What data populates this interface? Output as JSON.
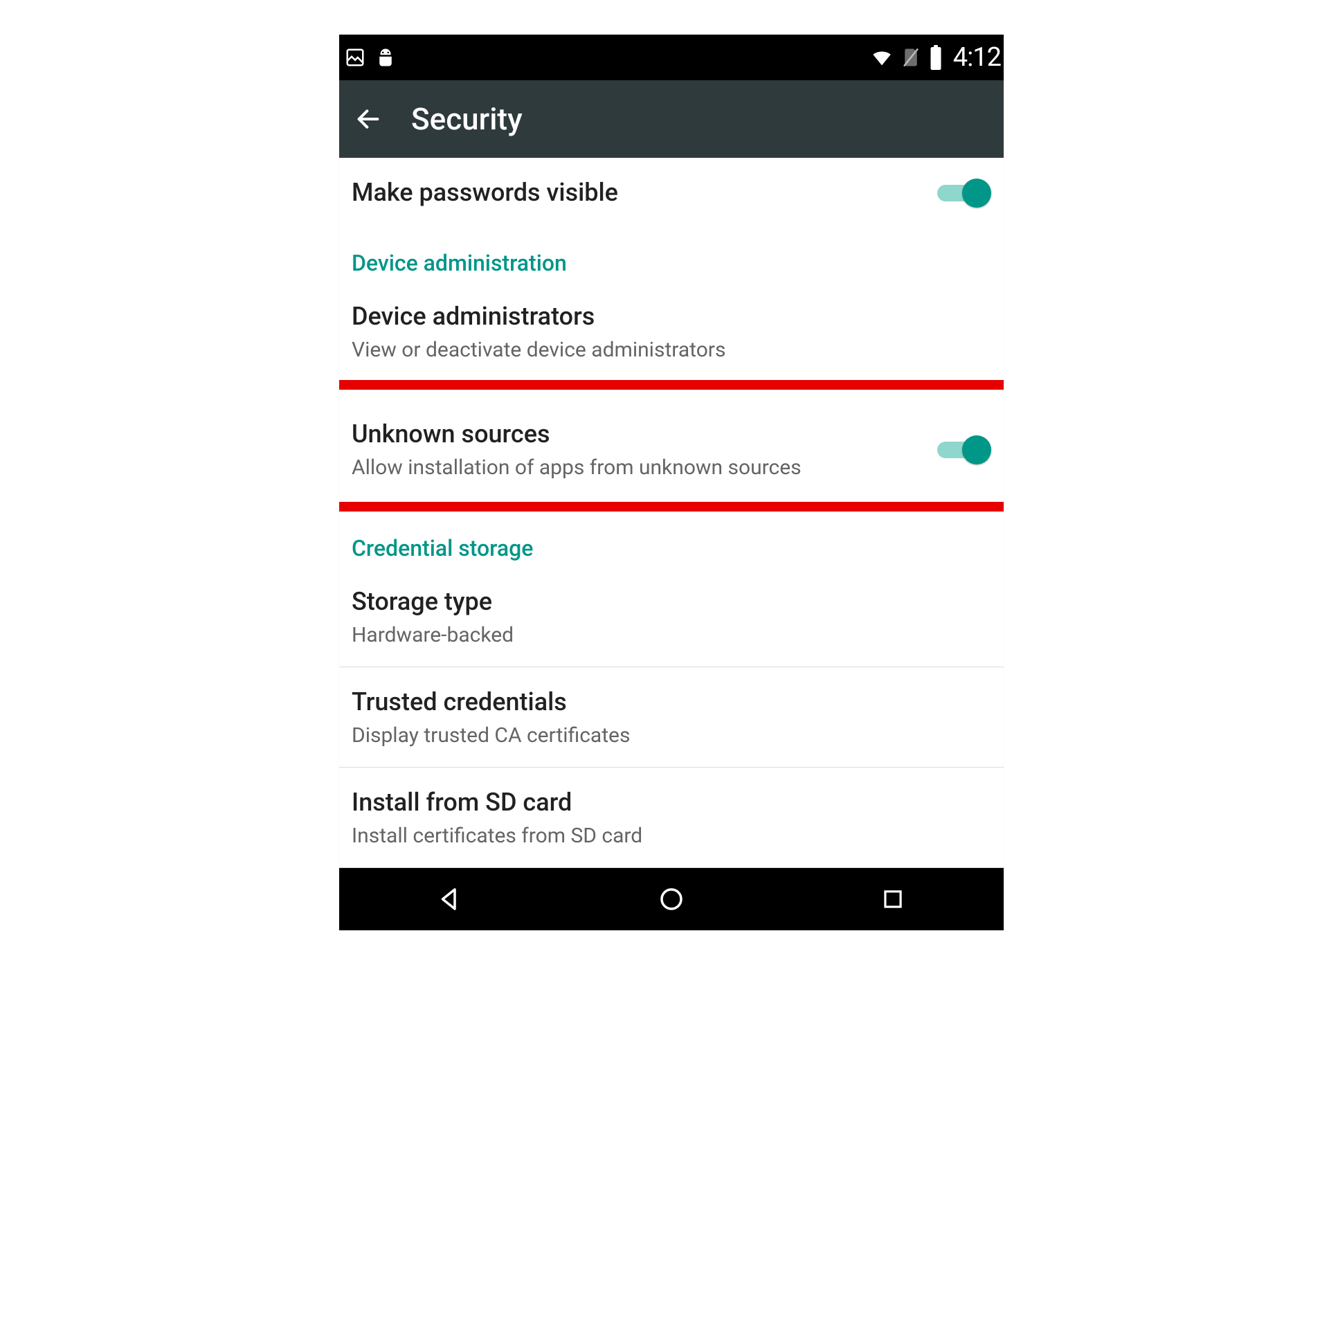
{
  "statusbar": {
    "time": "4:12"
  },
  "appbar": {
    "title": "Security"
  },
  "rows": {
    "make_passwords_visible": {
      "title": "Make passwords visible",
      "toggle": true
    }
  },
  "section_device_admin": "Device administration",
  "device_admins": {
    "title": "Device administrators",
    "sub": "View or deactivate device administrators"
  },
  "unknown_sources": {
    "title": "Unknown sources",
    "sub": "Allow installation of apps from unknown sources",
    "toggle": true
  },
  "section_credential": "Credential storage",
  "storage_type": {
    "title": "Storage type",
    "sub": "Hardware-backed"
  },
  "trusted_credentials": {
    "title": "Trusted credentials",
    "sub": "Display trusted CA certificates"
  },
  "install_sd": {
    "title": "Install from SD card",
    "sub": "Install certificates from SD card"
  }
}
